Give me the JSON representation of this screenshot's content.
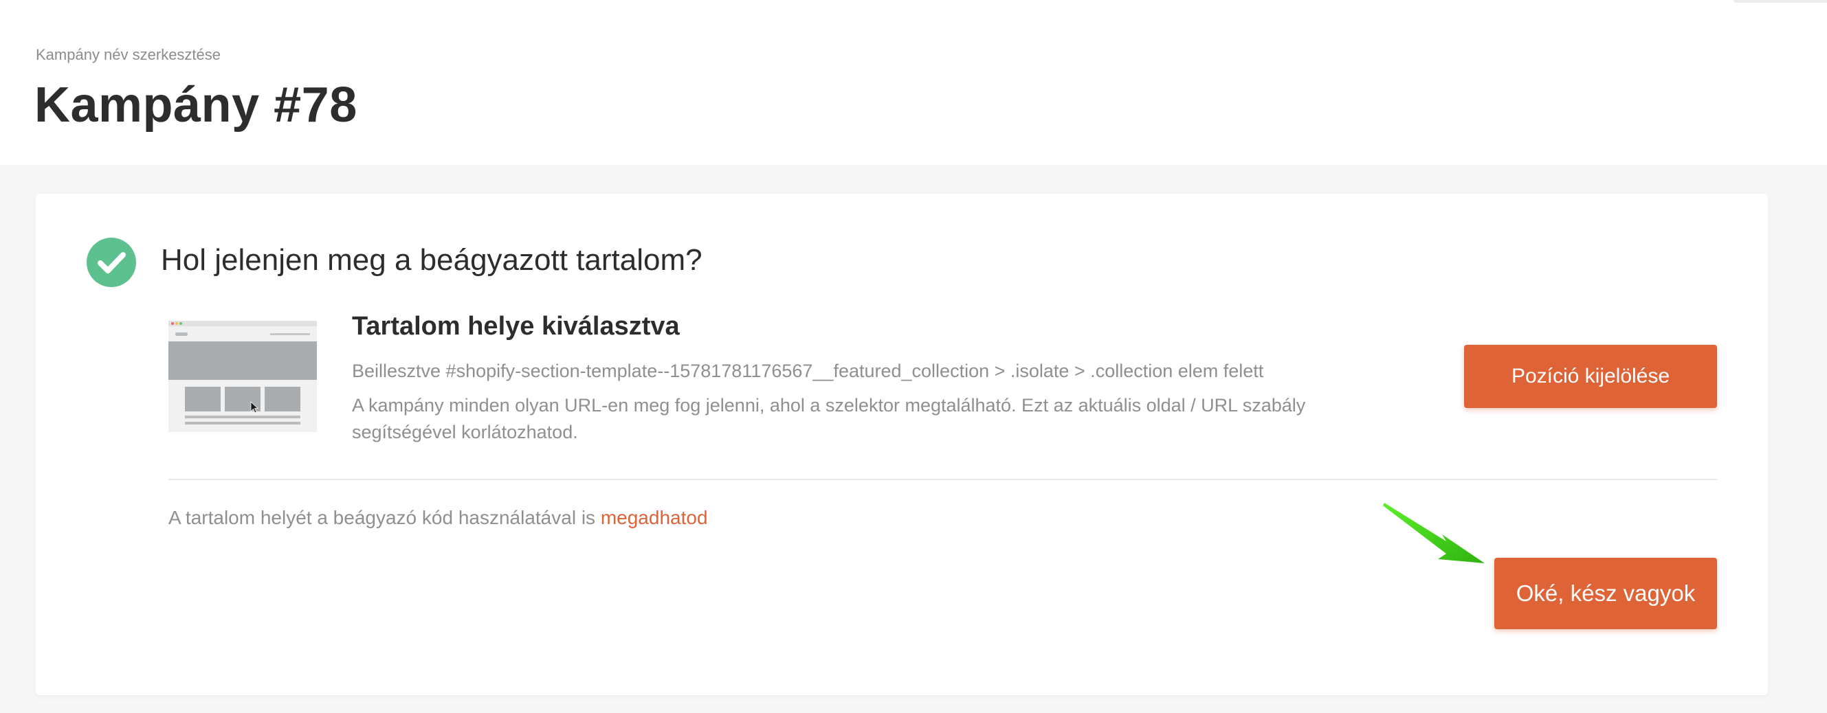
{
  "header": {
    "breadcrumb": "Kampány név szerkesztése",
    "title": "Kampány #78"
  },
  "card": {
    "section_title": "Hol jelenjen meg a beágyazott tartalom?",
    "status_icon": "check-circle-icon",
    "selection_heading": "Tartalom helye kiválasztva",
    "selector_text": "Beillesztve #shopify-section-template--15781781176567__featured_collection > .isolate > .collection elem felett",
    "info_text": "A kampány minden olyan URL-en meg fog jelenni, ahol a szelektor megtalálható. Ezt az aktuális oldal / URL szabály segítségével korlátozhatod.",
    "position_button_label": "Pozíció kijelölése",
    "embed_note_prefix": "A tartalom helyét a beágyazó kód használatával is",
    "embed_note_link": "megadhatod",
    "done_button_label": "Oké, kész vagyok"
  },
  "colors": {
    "accent": "#de6337",
    "success": "#5cc08f",
    "annotation_arrow": "#3fd11a"
  }
}
